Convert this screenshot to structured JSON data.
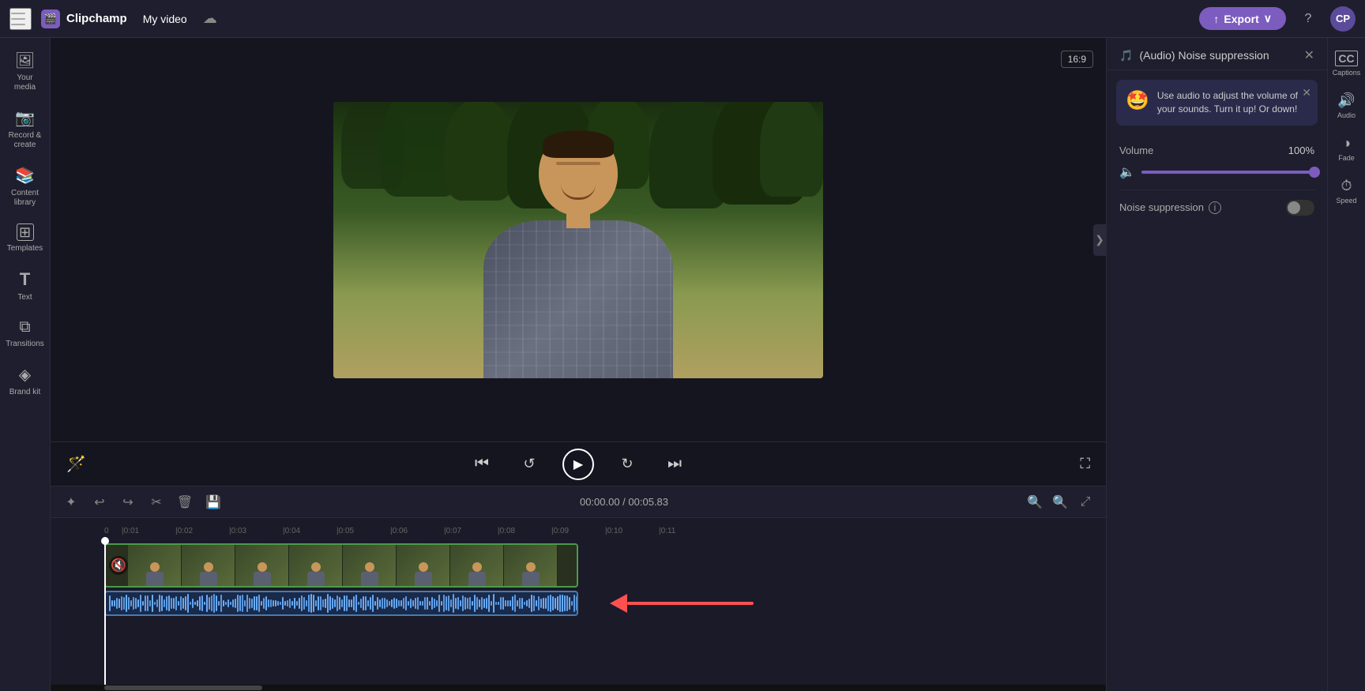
{
  "app": {
    "name": "Clipchamp",
    "logo_icon": "🎬",
    "video_title": "My video",
    "export_label": "Export"
  },
  "topbar": {
    "help_label": "?",
    "avatar_label": "CP"
  },
  "sidebar": {
    "items": [
      {
        "id": "your-media",
        "icon": "🖼",
        "label": "Your media"
      },
      {
        "id": "record",
        "icon": "📷",
        "label": "Record &\ncreate"
      },
      {
        "id": "content-library",
        "icon": "📚",
        "label": "Content\nlibrary"
      },
      {
        "id": "templates",
        "icon": "⊞",
        "label": "Templates"
      },
      {
        "id": "text",
        "icon": "T",
        "label": "Text"
      },
      {
        "id": "transitions",
        "icon": "⧉",
        "label": "Transitions"
      },
      {
        "id": "brand-kit",
        "icon": "◈",
        "label": "Brand kit"
      }
    ]
  },
  "preview": {
    "aspect_ratio": "16:9",
    "video_thumb_alt": "Man smiling outdoors"
  },
  "controls": {
    "skip_back_label": "⏮",
    "rewind_label": "↩",
    "play_label": "▶",
    "forward_label": "↪",
    "skip_forward_label": "⏭",
    "fullscreen_label": "⛶",
    "magic_label": "✨"
  },
  "timeline": {
    "current_time": "00:00.00",
    "total_time": "00:05.83",
    "time_display": "00:00.00 / 00:05.83",
    "ruler_marks": [
      "0",
      "|0:01",
      "|0:02",
      "|0:03",
      "|0:04",
      "|0:05",
      "|0:06",
      "|0:07",
      "|0:08",
      "|0:09",
      "|0:10",
      "|0:11"
    ],
    "toolbar_buttons": [
      {
        "id": "sparkle",
        "icon": "✦",
        "label": "magic"
      },
      {
        "id": "undo",
        "icon": "↩",
        "label": "undo"
      },
      {
        "id": "redo",
        "icon": "↪",
        "label": "redo"
      },
      {
        "id": "cut",
        "icon": "✂",
        "label": "cut"
      },
      {
        "id": "delete",
        "icon": "🗑",
        "label": "delete"
      },
      {
        "id": "save",
        "icon": "💾",
        "label": "save"
      }
    ]
  },
  "right_panel": {
    "title": "(Audio) Noise suppression",
    "title_icon": "🎵",
    "tooltip": {
      "emoji": "🤩",
      "text": "Use audio to adjust the volume of your sounds. Turn it up! Or down!"
    },
    "volume_label": "Volume",
    "volume_value": "100%",
    "volume_percent": 100,
    "noise_suppression_label": "Noise suppression",
    "noise_suppression_enabled": false
  },
  "right_mini_toolbar": {
    "items": [
      {
        "id": "captions",
        "icon": "CC",
        "label": "Captions"
      },
      {
        "id": "audio",
        "icon": "🔊",
        "label": "Audio"
      },
      {
        "id": "fade",
        "icon": "◑",
        "label": "Fade"
      },
      {
        "id": "speed",
        "icon": "⏱",
        "label": "Speed"
      }
    ]
  }
}
